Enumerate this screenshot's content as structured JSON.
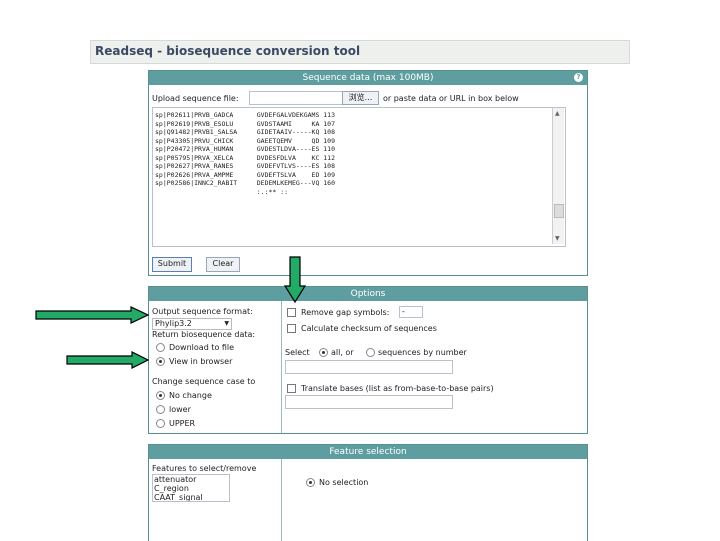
{
  "app": {
    "title": "Readseq - biosequence conversion tool"
  },
  "sequence_panel": {
    "header": "Sequence data (max 100MB)",
    "help_icon": "?",
    "upload_label": "Upload sequence file:",
    "browse_label": "浏览...",
    "or_paste_label": "or paste data or URL in box below",
    "sequences": [
      "sp|P02611|PRVB_GADCA      GVDEFGALVDEKGAMS 113",
      "sp|P02619|PRVB_ESOLU      GVDSTAAMI     KA 107",
      "sp|Q91482|PRVB1_SALSA     GIDETAAIV-----KQ 108",
      "sp|P43305|PRVU_CHICK      GAEETQEMV     QD 109",
      "sp|P20472|PRVA_HUMAN      GVDESTLDVA----ES 110",
      "sp|P05795|PRVA_XELCA      DVDESFDLVA    KC 112",
      "sp|P02627|PRVA_RANES      GVDEFVTLVS----ES 108",
      "sp|P02626|PRVA_AMPME      GVDEFTSLVA    ED 109",
      "sp|P02586|INNC2_RABIT     DEDEMLKEMEG---VQ 160",
      "                          :.:** ::"
    ],
    "submit_label": "Submit",
    "clear_label": "Clear"
  },
  "options_panel": {
    "header": "Options",
    "output_format_label": "Output sequence format:",
    "output_format_value": "Phylip3.2",
    "return_label": "Return biosequence data:",
    "return_options": [
      "Download to file",
      "View in browser"
    ],
    "return_selected": 1,
    "case_label": "Change sequence case to",
    "case_options": [
      "No change",
      "lower",
      "UPPER"
    ],
    "case_selected": 0,
    "remove_gap_label": "Remove gap symbols:",
    "remove_gap_value": "-",
    "checksum_label": "Calculate checksum of sequences",
    "select_label": "Select",
    "select_all_label": "all, or",
    "select_number_label": "sequences by number",
    "translate_label": "Translate bases (list as from-base-to-base pairs)"
  },
  "feature_panel": {
    "header": "Feature selection",
    "list_label": "Features to select/remove",
    "features": [
      "attenuator",
      "C_region",
      "CAAT_signal"
    ],
    "no_selection_label": "No selection"
  },
  "colors": {
    "panel_header": "#5f9ea0",
    "arrow_fill": "#22aa66",
    "title_text": "#3a4a63"
  }
}
